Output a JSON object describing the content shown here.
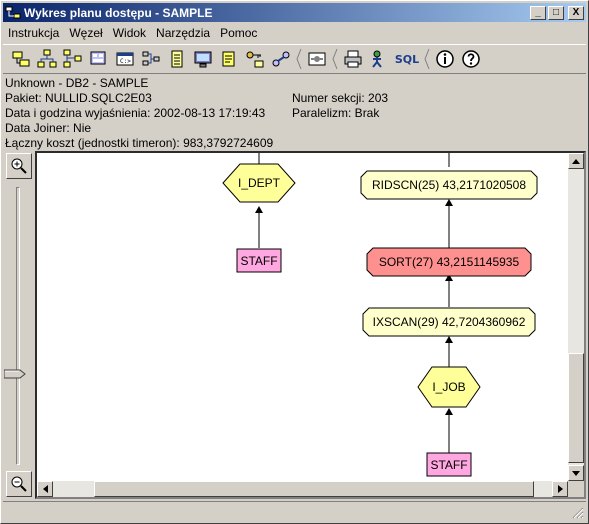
{
  "window": {
    "title": "Wykres planu dostępu - SAMPLE",
    "controls": {
      "minimize": "_",
      "maximize": "□",
      "close": "X"
    }
  },
  "menu": [
    "Instrukcja",
    "Węzeł",
    "Widok",
    "Narzędzia",
    "Pomoc"
  ],
  "toolbar": {
    "tools": [
      "open-icon",
      "tree-icon",
      "tree-expand-icon",
      "database-icon",
      "command-icon",
      "graph-icon",
      "list-icon",
      "monitor-icon",
      "notes-icon",
      "keys-icon",
      "link-icon",
      "settings-icon",
      "print-icon",
      "explain-icon",
      "sql-icon",
      "info-icon",
      "help-icon"
    ],
    "sql_label": "SQL"
  },
  "info": {
    "line1": "Unknown - DB2 - SAMPLE",
    "package": "Pakiet: NULLID.SQLC2E03",
    "section": "Numer sekcji: 203",
    "datetime": "Data i godzina wyjaśnienia: 2002-08-13 17:19:43",
    "parallelism": "Paralelizm: Brak",
    "joiner": "Data Joiner: Nie",
    "total_cost": "Łączny koszt (jednostki timeron): 983,3792724609"
  },
  "graph": {
    "nodes": [
      {
        "id": "idept",
        "label": "I_DEPT",
        "kind": "index",
        "fill": "#ffff99"
      },
      {
        "id": "staff1",
        "label": "STAFF",
        "kind": "table",
        "fill": "#ffa7e0"
      },
      {
        "id": "ridscn",
        "label": "RIDSCN(25) 43,2171020508",
        "kind": "operator",
        "fill": "#ffffcc"
      },
      {
        "id": "sort",
        "label": "SORT(27) 43,2151145935",
        "kind": "operator",
        "fill": "#ff9090"
      },
      {
        "id": "ixscan",
        "label": "IXSCAN(29) 42,7204360962",
        "kind": "operator",
        "fill": "#ffffcc"
      },
      {
        "id": "ijob",
        "label": "I_JOB",
        "kind": "index",
        "fill": "#ffff99"
      },
      {
        "id": "staff2",
        "label": "STAFF",
        "kind": "table",
        "fill": "#ffa7e0"
      }
    ]
  },
  "colors": {
    "title_start": "#0a246a",
    "title_end": "#a6caf0",
    "chrome": "#d4d0c8"
  }
}
